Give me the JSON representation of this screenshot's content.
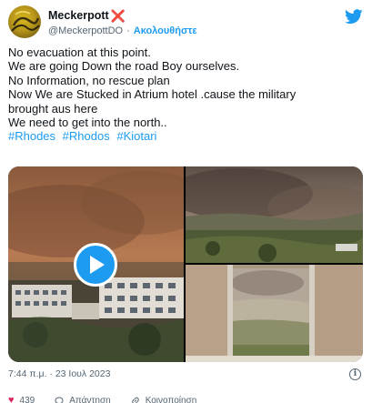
{
  "user": {
    "display_name": "Meckerpott",
    "badge": "❌",
    "handle": "@MeckerpottDO",
    "separator": "·",
    "follow_label": "Ακολουθήστε"
  },
  "tweet": {
    "lines": [
      "No evacuation at this point.",
      "We are going Down the road Boy ourselves.",
      "No Information, no rescue plan",
      "Now We are Stucked in Atrium hotel .cause the military",
      "brought aus here",
      "We need to get into the north.."
    ],
    "hashtags": [
      "#Rhodes",
      "#Rhodos",
      "#Kiotari"
    ]
  },
  "meta": {
    "timestamp": "7:44 π.μ. · 23 Ιουλ 2023",
    "info_symbol": "i"
  },
  "actions": {
    "likes": "439",
    "reply_label": "Απάντηση",
    "copy_label": "Κοινοποίηση"
  },
  "colors": {
    "accent": "#1d9bf0",
    "text": "#0f1419",
    "muted": "#536471",
    "badge_red": "#e0245e"
  },
  "icons": [
    "avatar",
    "cross-mark-icon",
    "twitter-bird-icon",
    "play-icon",
    "info-icon",
    "heart-icon",
    "reply-icon",
    "link-icon"
  ]
}
